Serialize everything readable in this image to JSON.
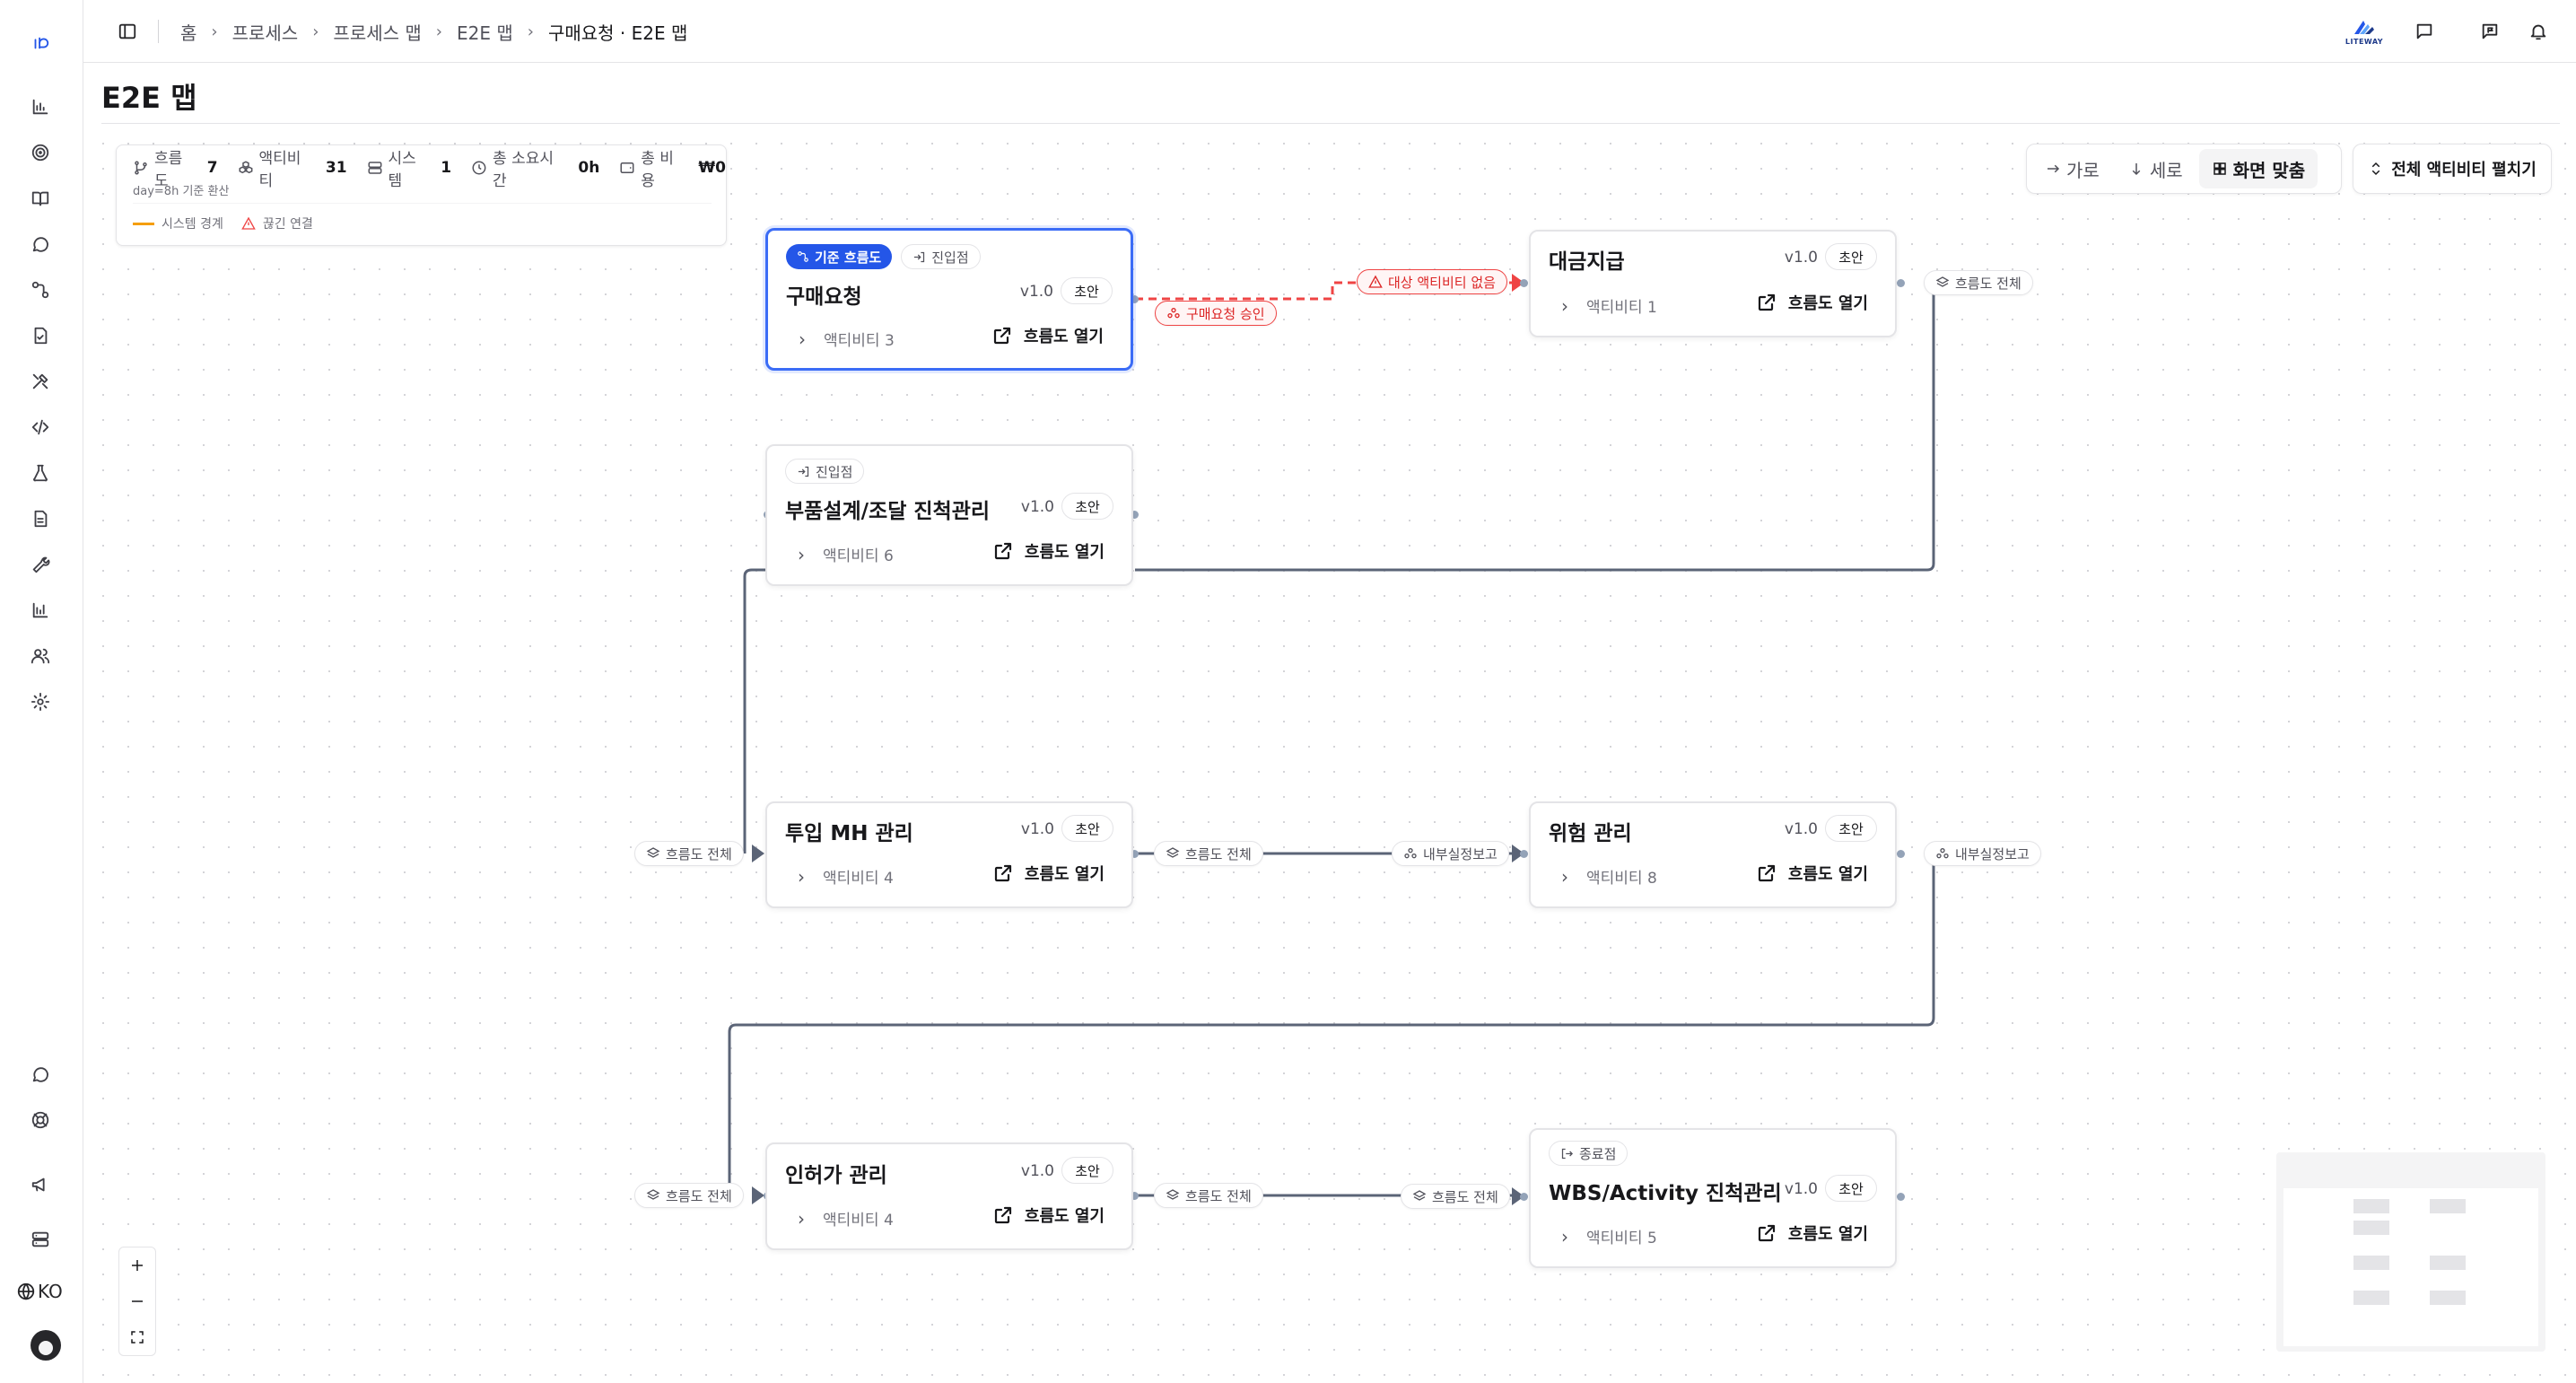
{
  "breadcrumb": {
    "items": [
      "홈",
      "프로세스",
      "프로세스 맵",
      "E2E 맵"
    ],
    "current": "구매요청 · E2E 맵"
  },
  "brand": {
    "logo_text": "LITEWAY"
  },
  "page": {
    "title": "E2E 맵"
  },
  "stats": {
    "flows_label": "흐름도",
    "flows_value": "7",
    "activities_label": "액티비티",
    "activities_value": "31",
    "systems_label": "시스템",
    "systems_value": "1",
    "time_label": "총 소요시간",
    "time_value": "0h",
    "cost_label": "총 비용",
    "cost_value": "₩0",
    "subtitle": "day=8h 기준 환산",
    "legend_boundary": "시스템 경계",
    "legend_broken": "끊긴 연결"
  },
  "toolbar": {
    "horizontal": "가로",
    "vertical": "세로",
    "fit": "화면 맞춤",
    "expand_all": "전체 액티비티 펼치기"
  },
  "nodes": {
    "purchase": {
      "tag_base": "기준 흐름도",
      "tag_entry": "진입점",
      "title": "구매요청",
      "version": "v1.0",
      "status": "초안",
      "activities": "액티비티 3",
      "open": "흐름도 열기"
    },
    "payment": {
      "title": "대금지급",
      "version": "v1.0",
      "status": "초안",
      "activities": "액티비티 1",
      "open": "흐름도 열기"
    },
    "parts": {
      "tag_entry": "진입점",
      "title": "부품설계/조달 진척관리",
      "version": "v1.0",
      "status": "초안",
      "activities": "액티비티 6",
      "open": "흐름도 열기"
    },
    "mh": {
      "title": "투입 MH 관리",
      "version": "v1.0",
      "status": "초안",
      "activities": "액티비티 4",
      "open": "흐름도 열기"
    },
    "risk": {
      "title": "위험 관리",
      "version": "v1.0",
      "status": "초안",
      "activities": "액티비티 8",
      "open": "흐름도 열기"
    },
    "permit": {
      "title": "인허가 관리",
      "version": "v1.0",
      "status": "초안",
      "activities": "액티비티 4",
      "open": "흐름도 열기"
    },
    "wbs": {
      "tag_end": "종료점",
      "title": "WBS/Activity 진척관리",
      "version": "v1.0",
      "status": "초안",
      "activities": "액티비티 5",
      "open": "흐름도 열기"
    }
  },
  "edges": {
    "approval": "구매요청 승인",
    "no_target": "대상 액티비티 없음",
    "all_flow": "흐름도 전체",
    "internal_report": "내부실정보고"
  },
  "sidebar": {
    "language": "KO"
  },
  "colors": {
    "accent": "#2456e8",
    "edge": "#5b6477",
    "broken": "#ef4444",
    "boundary": "#f59e0b"
  }
}
